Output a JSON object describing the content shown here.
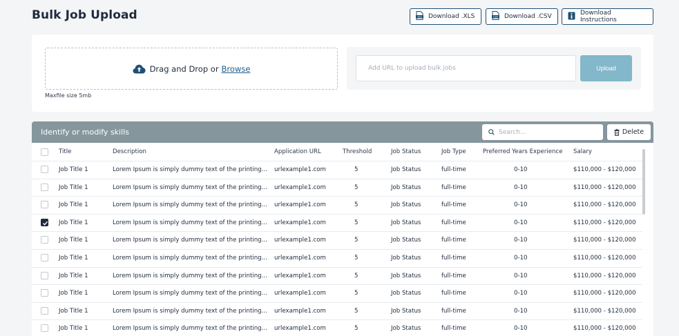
{
  "page": {
    "title": "Bulk Job Upload"
  },
  "toolbar": {
    "download_xls": "Download .XLS",
    "download_csv": "Download .CSV",
    "download_instructions": "Download Instructions"
  },
  "upload": {
    "drag_text": "Drag and Drop or",
    "browse_text": "Browse",
    "max_size": "Maxfile size 5mb",
    "url_placeholder": "Add URL to upload bulk jobs",
    "upload_button": "Upload"
  },
  "table": {
    "title": "Identify or modify skills",
    "search_placeholder": "Search...",
    "delete_label": "Delete",
    "columns": [
      "Title",
      "Description",
      "Application URL",
      "Threshold",
      "Job Status",
      "Job Type",
      "Preferred Years Experience",
      "Salary"
    ],
    "rows": [
      {
        "checked": false,
        "title": "Job Title 1",
        "description": "Lorem Ipsum is simply dummy text of the printing...",
        "url": "urlexample1.com",
        "threshold": "5",
        "status": "Job Status",
        "type": "full-time",
        "experience": "0-10",
        "salary": "$110,000 - $120,000"
      },
      {
        "checked": false,
        "title": "Job Title 1",
        "description": "Lorem Ipsum is simply dummy text of the printing...",
        "url": "urlexample1.com",
        "threshold": "5",
        "status": "Job Status",
        "type": "full-time",
        "experience": "0-10",
        "salary": "$110,000 - $120,000"
      },
      {
        "checked": false,
        "title": "Job Title 1",
        "description": "Lorem Ipsum is simply dummy text of the printing...",
        "url": "urlexample1.com",
        "threshold": "5",
        "status": "Job Status",
        "type": "full-time",
        "experience": "0-10",
        "salary": "$110,000 - $120,000"
      },
      {
        "checked": true,
        "title": "Job Title 1",
        "description": "Lorem Ipsum is simply dummy text of the printing...",
        "url": "urlexample1.com",
        "threshold": "5",
        "status": "Job Status",
        "type": "full-time",
        "experience": "0-10",
        "salary": "$110,000 - $120,000"
      },
      {
        "checked": false,
        "title": "Job Title 1",
        "description": "Lorem Ipsum is simply dummy text of the printing...",
        "url": "urlexample1.com",
        "threshold": "5",
        "status": "Job Status",
        "type": "full-time",
        "experience": "0-10",
        "salary": "$110,000 - $120,000"
      },
      {
        "checked": false,
        "title": "Job Title 1",
        "description": "Lorem Ipsum is simply dummy text of the printing...",
        "url": "urlexample1.com",
        "threshold": "5",
        "status": "Job Status",
        "type": "full-time",
        "experience": "0-10",
        "salary": "$110,000 - $120,000"
      },
      {
        "checked": false,
        "title": "Job Title 1",
        "description": "Lorem Ipsum is simply dummy text of the printing...",
        "url": "urlexample1.com",
        "threshold": "5",
        "status": "Job Status",
        "type": "full-time",
        "experience": "0-10",
        "salary": "$110,000 - $120,000"
      },
      {
        "checked": false,
        "title": "Job Title 1",
        "description": "Lorem Ipsum is simply dummy text of the printing...",
        "url": "urlexample1.com",
        "threshold": "5",
        "status": "Job Status",
        "type": "full-time",
        "experience": "0-10",
        "salary": "$110,000 - $120,000"
      },
      {
        "checked": false,
        "title": "Job Title 1",
        "description": "Lorem Ipsum is simply dummy text of the printing...",
        "url": "urlexample1.com",
        "threshold": "5",
        "status": "Job Status",
        "type": "full-time",
        "experience": "0-10",
        "salary": "$110,000 - $120,000"
      },
      {
        "checked": false,
        "title": "Job Title 1",
        "description": "Lorem Ipsum is simply dummy text of the printing...",
        "url": "urlexample1.com",
        "threshold": "5",
        "status": "Job Status",
        "type": "full-time",
        "experience": "0-10",
        "salary": "$110,000 - $120,000"
      }
    ]
  },
  "icons": {
    "xls": "xls-file-icon",
    "csv": "csv-file-icon",
    "instructions": "info-icon",
    "upload": "cloud-upload-icon",
    "search": "search-icon",
    "delete": "trash-icon",
    "check": "check-icon"
  },
  "colors": {
    "accent": "#1f4f73",
    "upload_button": "#83b7ca",
    "table_header": "#85969d",
    "link": "#1f5f8b"
  }
}
